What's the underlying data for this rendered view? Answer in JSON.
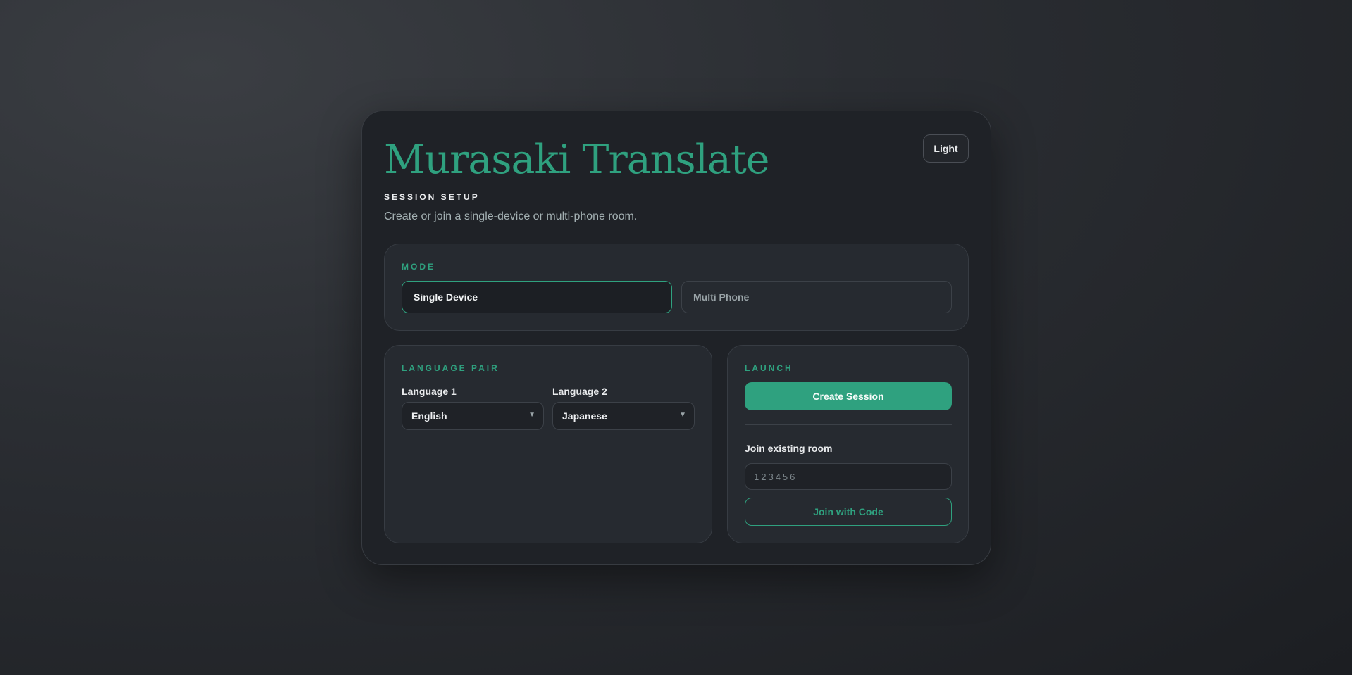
{
  "app": {
    "title": "Murasaki Translate",
    "eyebrow": "SESSION SETUP",
    "subtitle": "Create or join a single-device or multi-phone room.",
    "theme_toggle_label": "Light"
  },
  "mode": {
    "section_label": "MODE",
    "options": [
      {
        "label": "Single Device",
        "selected": true
      },
      {
        "label": "Multi Phone",
        "selected": false
      }
    ]
  },
  "language_pair": {
    "section_label": "LANGUAGE PAIR",
    "language1": {
      "label": "Language 1",
      "value": "English"
    },
    "language2": {
      "label": "Language 2",
      "value": "Japanese"
    }
  },
  "launch": {
    "section_label": "LAUNCH",
    "create_button_label": "Create Session",
    "join_label": "Join existing room",
    "code_placeholder": "123456",
    "join_button_label": "Join with Code"
  },
  "colors": {
    "accent": "#2fa17f",
    "background": "#2b2e33",
    "card": "#1f2227",
    "panel": "#262a30"
  },
  "icons": {
    "select_caret": "chevron-down-icon"
  }
}
